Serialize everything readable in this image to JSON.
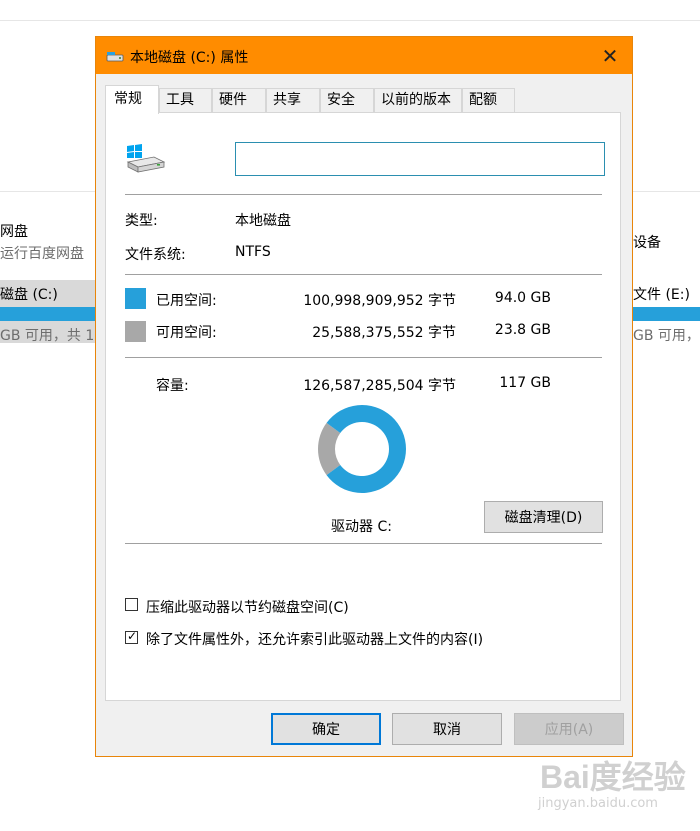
{
  "background": {
    "left": {
      "item1_title": "网盘",
      "item1_sub": "运行百度网盘",
      "item2_title": "磁盘 (C:)",
      "item2_sub": "GB 可用，共 1"
    },
    "right": {
      "item1_title": "设备",
      "item2_title": "文件 (E:)",
      "item2_sub": "GB 可用，"
    }
  },
  "dialog": {
    "title": "本地磁盘 (C:) 属性",
    "close_label": "✕",
    "tabs": [
      {
        "label": "常规",
        "active": true
      },
      {
        "label": "工具",
        "active": false
      },
      {
        "label": "硬件",
        "active": false
      },
      {
        "label": "共享",
        "active": false
      },
      {
        "label": "安全",
        "active": false
      },
      {
        "label": "以前的版本",
        "active": false
      },
      {
        "label": "配额",
        "active": false
      }
    ],
    "drive_name_value": "",
    "type_label": "类型:",
    "type_value": "本地磁盘",
    "fs_label": "文件系统:",
    "fs_value": "NTFS",
    "used_label": "已用空间:",
    "used_bytes": "100,998,909,952 字节",
    "used_gb": "94.0 GB",
    "free_label": "可用空间:",
    "free_bytes": "25,588,375,552 字节",
    "free_gb": "23.8 GB",
    "capacity_label": "容量:",
    "capacity_bytes": "126,587,285,504 字节",
    "capacity_gb": "117 GB",
    "used_fraction": 0.798,
    "used_color": "#26a0da",
    "free_color": "#a8a8a8",
    "drive_label": "驱动器 C:",
    "cleanup_button": "磁盘清理(D)",
    "compress_label": "压缩此驱动器以节约磁盘空间(C)",
    "compress_checked": false,
    "index_label": "除了文件属性外，还允许索引此驱动器上文件的内容(I)",
    "index_checked": true,
    "ok_button": "确定",
    "cancel_button": "取消",
    "apply_button": "应用(A)"
  },
  "watermark": {
    "main": "Bai度经验",
    "sub": "jingyan.baidu.com"
  }
}
